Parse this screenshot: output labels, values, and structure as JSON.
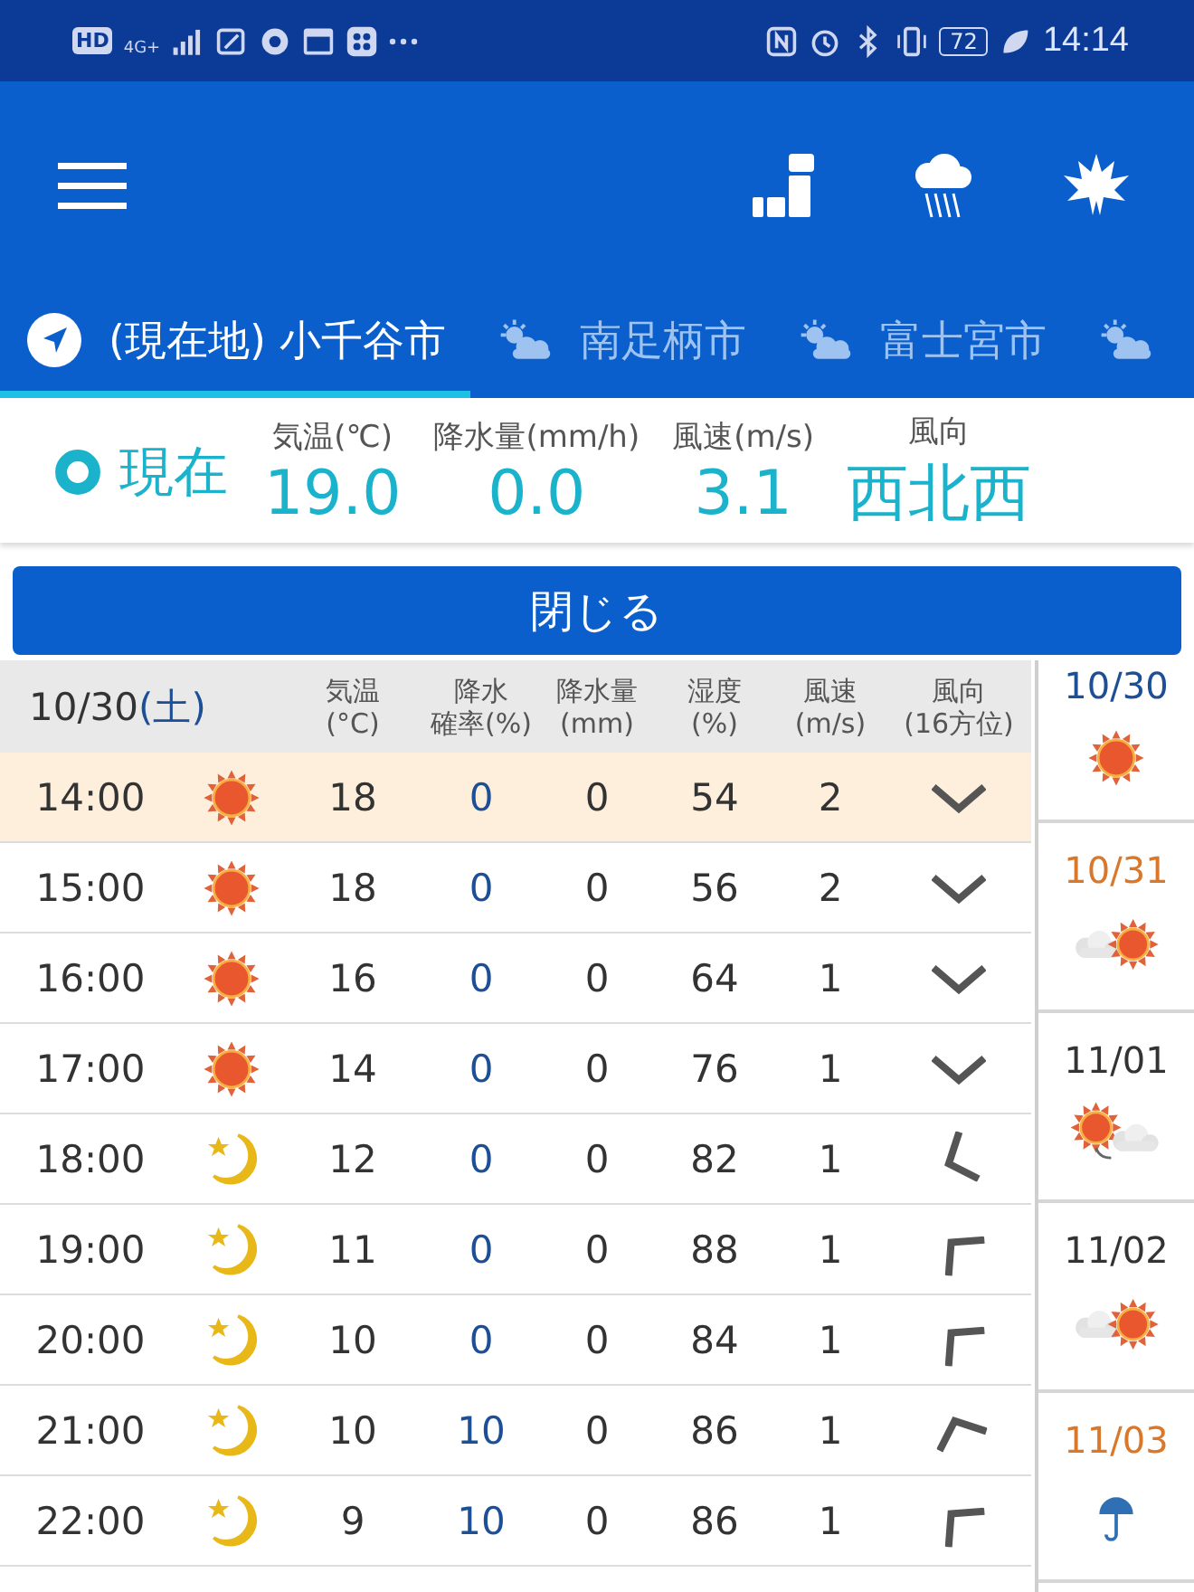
{
  "status_bar": {
    "network": [
      "HD",
      "4G+"
    ],
    "battery": "72",
    "time": "14:14"
  },
  "tabs": [
    {
      "label": "(現在地) 小千谷市",
      "kind": "location",
      "selected": true
    },
    {
      "label": "南足柄市",
      "kind": "weather",
      "selected": false
    },
    {
      "label": "富士宮市",
      "kind": "weather",
      "selected": false
    },
    {
      "kind": "weather",
      "selected": false
    }
  ],
  "current": {
    "label": "現在",
    "items": [
      {
        "heading": "気温(℃)",
        "value": "19.0"
      },
      {
        "heading": "降水量(mm/h)",
        "value": "0.0"
      },
      {
        "heading": "風速(m/s)",
        "value": "3.1"
      },
      {
        "heading": "風向",
        "value": "西北西"
      }
    ]
  },
  "close_button": "閉じる",
  "table": {
    "date": "10/30",
    "weekday": "(土)",
    "columns": [
      {
        "line1": "気温",
        "line2": "(°C)"
      },
      {
        "line1": "降水",
        "line2": "確率(%)"
      },
      {
        "line1": "降水量",
        "line2": "(mm)"
      },
      {
        "line1": "湿度",
        "line2": "(%)"
      },
      {
        "line1": "風速",
        "line2": "(m/s)"
      },
      {
        "line1": "風向",
        "line2": "(16方位)"
      }
    ],
    "rows": [
      {
        "time": "14:00",
        "kind": "sunny",
        "temp": "18",
        "prob": "0",
        "amount": "0",
        "humidity": "54",
        "speed": "2",
        "wind": {
          "kind": "N"
        },
        "current": true
      },
      {
        "time": "15:00",
        "kind": "sunny",
        "temp": "18",
        "prob": "0",
        "amount": "0",
        "humidity": "56",
        "speed": "2",
        "wind": {
          "kind": "N"
        },
        "current": false
      },
      {
        "time": "16:00",
        "kind": "sunny",
        "temp": "16",
        "prob": "0",
        "amount": "0",
        "humidity": "64",
        "speed": "1",
        "wind": {
          "kind": "N"
        },
        "current": false
      },
      {
        "time": "17:00",
        "kind": "sunny",
        "temp": "14",
        "prob": "0",
        "amount": "0",
        "humidity": "76",
        "speed": "1",
        "wind": {
          "kind": "N"
        },
        "current": false
      },
      {
        "time": "18:00",
        "kind": "night",
        "temp": "12",
        "prob": "0",
        "amount": "0",
        "humidity": "82",
        "speed": "1",
        "wind": {
          "kind": "ENE"
        },
        "current": false
      },
      {
        "time": "19:00",
        "kind": "night",
        "temp": "11",
        "prob": "0",
        "amount": "0",
        "humidity": "88",
        "speed": "1",
        "wind": {
          "kind": "SE"
        },
        "current": false
      },
      {
        "time": "20:00",
        "kind": "night",
        "temp": "10",
        "prob": "0",
        "amount": "0",
        "humidity": "84",
        "speed": "1",
        "wind": {
          "kind": "SE"
        },
        "current": false
      },
      {
        "time": "21:00",
        "kind": "night",
        "temp": "10",
        "prob": "10",
        "amount": "0",
        "humidity": "86",
        "speed": "1",
        "wind": {
          "kind": "SSE"
        },
        "current": false
      },
      {
        "time": "22:00",
        "kind": "night",
        "temp": "9",
        "prob": "10",
        "amount": "0",
        "humidity": "86",
        "speed": "1",
        "wind": {
          "kind": "SE"
        },
        "current": false
      }
    ]
  },
  "days": [
    {
      "date": "10/30",
      "color": "#1d4f96",
      "kind": "sunny"
    },
    {
      "date": "10/31",
      "color": "#d9782b",
      "kind": "cloudy-sunny"
    },
    {
      "date": "11/01",
      "color": "#333333",
      "kind": "sunny-cloudy"
    },
    {
      "date": "11/02",
      "color": "#333333",
      "kind": "cloudy-sunny"
    },
    {
      "date": "11/03",
      "color": "#d9782b",
      "kind": "rain"
    }
  ]
}
